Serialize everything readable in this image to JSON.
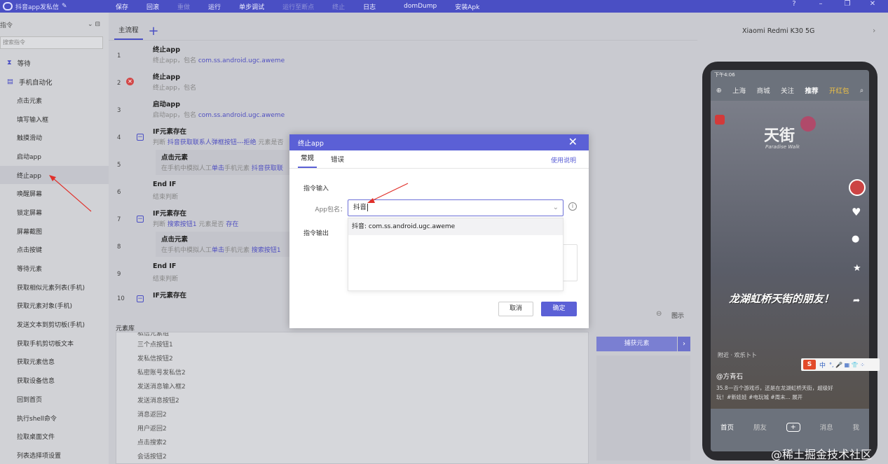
{
  "app": {
    "title": "抖音app发私信",
    "toolbar": [
      "保存",
      "回滚",
      "重做",
      "运行",
      "单步调试",
      "运行至断点",
      "终止",
      "日志",
      "domDump",
      "安装Apk"
    ]
  },
  "sidebar": {
    "header": "指令",
    "search_placeholder": "搜索指令",
    "groups": [
      {
        "label": "等待",
        "icon": "hourglass-icon"
      },
      {
        "label": "手机自动化",
        "icon": "phone-auto-icon"
      }
    ],
    "items": [
      "点击元素",
      "填写输入框",
      "触摸滑动",
      "启动app",
      "终止app",
      "唤醒屏幕",
      "锁定屏幕",
      "屏幕截图",
      "点击按键",
      "等待元素",
      "获取相似元素列表(手机)",
      "获取元素对象(手机)",
      "发送文本到剪切板(手机)",
      "获取手机剪切板文本",
      "获取元素信息",
      "获取设备信息",
      "回到首页",
      "执行shell命令",
      "拉取桌面文件",
      "列表选择项设置"
    ],
    "active_index": 4
  },
  "main": {
    "tab": "主流程",
    "rows": [
      {
        "num": "1",
        "title": "终止app",
        "desc": "终止app，包名",
        "desc_link": "com.ss.android.ugc.aweme"
      },
      {
        "num": "2",
        "title": "终止app",
        "desc": "终止app，包名",
        "desc_link": ""
      },
      {
        "num": "3",
        "title": "启动app",
        "desc": "启动app，包名",
        "desc_link": "com.ss.android.ugc.aweme"
      },
      {
        "num": "4",
        "title": "IF元素存在",
        "desc": "判断",
        "desc_link": "抖音获取联系人弹框按钮---拒绝",
        "desc_tail": "元素是否"
      },
      {
        "num": "5",
        "title": "点击元素",
        "desc": "在手机中模拟人工",
        "desc_link": "单击",
        "desc_tail": "手机元素",
        "desc_link2": "抖音获取联"
      },
      {
        "num": "6",
        "title": "End IF",
        "desc": "结束判断",
        "desc_link": ""
      },
      {
        "num": "7",
        "title": "IF元素存在",
        "desc": "判断",
        "desc_link": "搜索按钮1",
        "desc_tail": "元素是否",
        "desc_link2": "存在"
      },
      {
        "num": "8",
        "title": "点击元素",
        "desc": "在手机中模拟人工",
        "desc_link": "单击",
        "desc_tail": "手机元素",
        "desc_link2": "搜索按钮1"
      },
      {
        "num": "9",
        "title": "End IF",
        "desc": "结束判断",
        "desc_link": ""
      },
      {
        "num": "10",
        "title": "IF元素存在",
        "desc": "",
        "desc_link": ""
      }
    ]
  },
  "element_lib": {
    "title": "元素库",
    "chart_label": "图示",
    "items": [
      "私信元素组",
      "三个点按钮1",
      "发私信按钮2",
      "私密账号发私信2",
      "发送消息输入框2",
      "发送消息按钮2",
      "消息返回2",
      "用户返回2",
      "点击搜索2",
      "会话按钮2"
    ],
    "capture_label": "捕获元素"
  },
  "device": {
    "name": "Xiaomi Redmi K30 5G",
    "status_time": "下午4:06",
    "top_tabs": [
      "上海",
      "商城",
      "关注",
      "推荐",
      "开红包"
    ],
    "overlay_text": "龙湖虹桥天街的朋友！",
    "location": "附近 · 欢乐卜卜",
    "author": "@方青石",
    "description": "35.8一百个游戏币，还是在龙湖虹桥天街，超级好玩！#新娃娃 #电玩城 #周末... 展开",
    "bottom_nav": [
      "首页",
      "朋友",
      "+",
      "消息",
      "我"
    ],
    "store_sign": "天街",
    "store_sign_sub": "Paradise Walk"
  },
  "ime": {
    "label": "中",
    "symbols": "°, 🎤 ▦ 👕 ⁘"
  },
  "watermark": "@稀土掘金技术社区",
  "dialog": {
    "title": "终止app",
    "tabs": [
      "常规",
      "错误"
    ],
    "help": "使用说明",
    "input_section": "指令输入",
    "field_label": "App包名：",
    "field_value": "抖音",
    "option": "抖音: com.ss.android.ugc.aweme",
    "output_section": "指令输出",
    "cancel": "取消",
    "ok": "确定"
  },
  "colors": {
    "accent": "#5b60d6",
    "error": "#d24848",
    "link": "#5050c0"
  }
}
